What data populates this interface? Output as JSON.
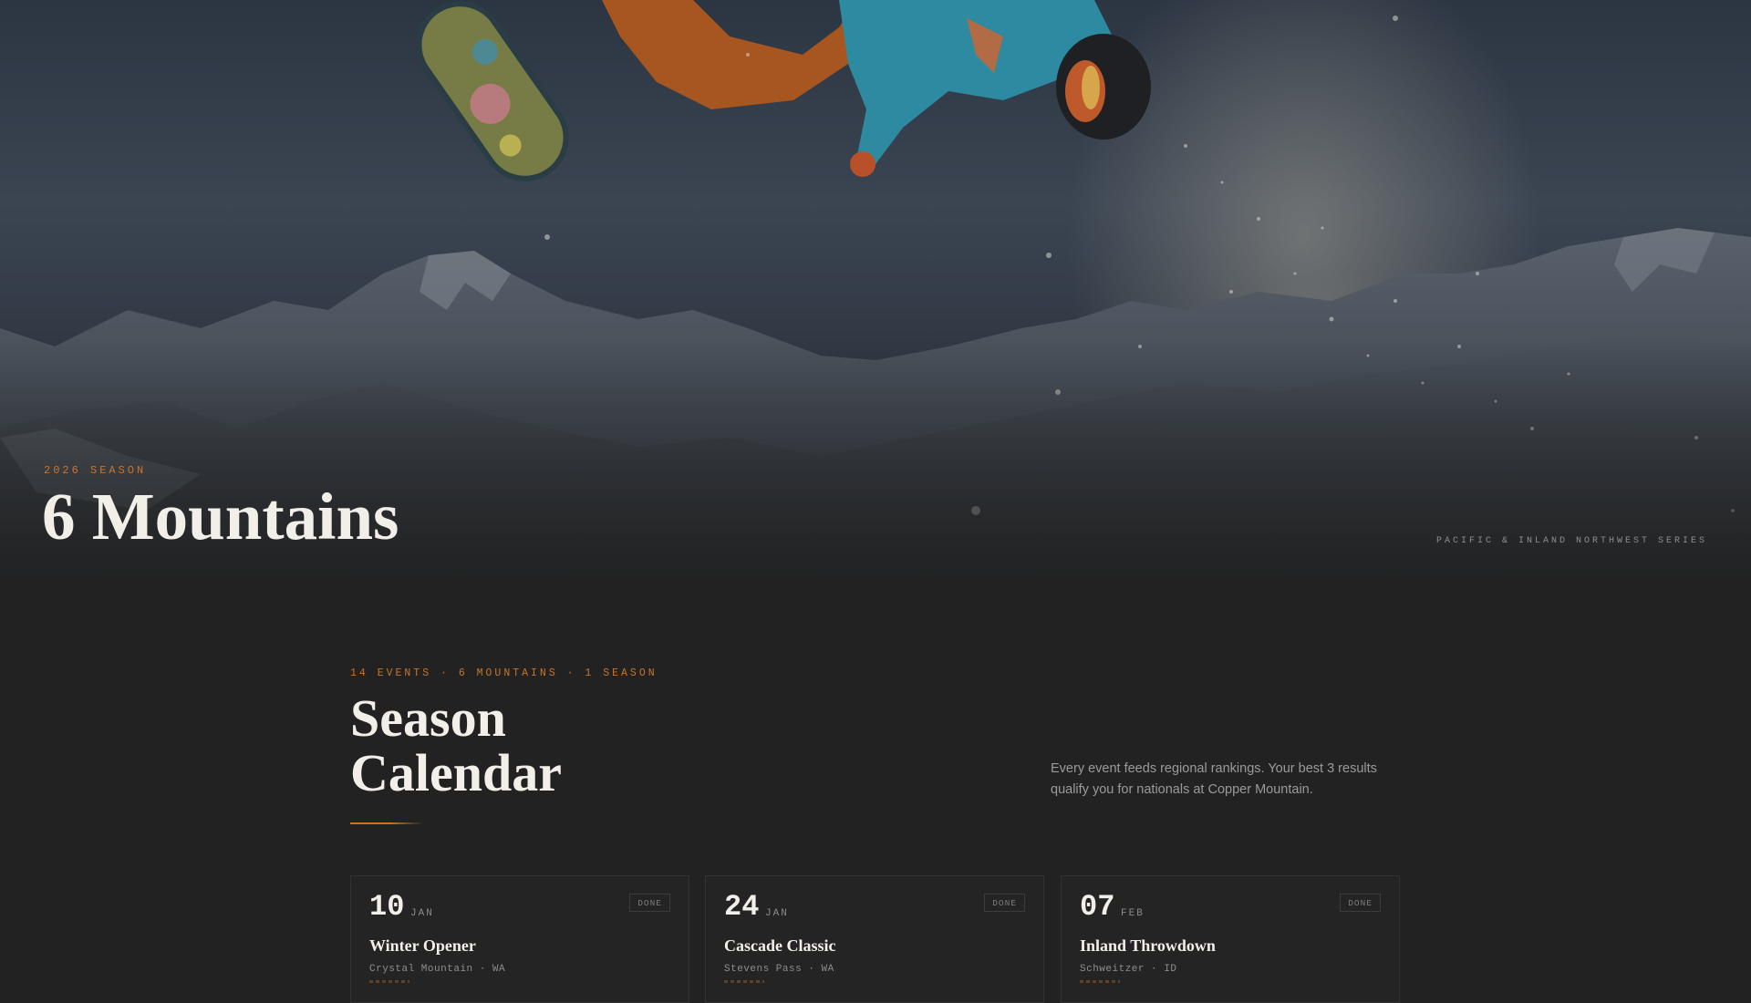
{
  "hero": {
    "eyebrow": "2026 SEASON",
    "title": "6 Mountains",
    "series": "PACIFIC & INLAND NORTHWEST SERIES",
    "background_image": "snowboarder-mountains-photo"
  },
  "calendar": {
    "eyebrow": "14 EVENTS · 6 MOUNTAINS · 1 SEASON",
    "title": "Season Calendar",
    "description": "Every event feeds regional rankings. Your best 3 results qualify you for nationals at Copper Mountain.",
    "events": [
      {
        "day": "10",
        "month": "JAN",
        "status": "DONE",
        "name": "Winter Opener",
        "location": "Crystal Mountain · WA"
      },
      {
        "day": "24",
        "month": "JAN",
        "status": "DONE",
        "name": "Cascade Classic",
        "location": "Stevens Pass · WA"
      },
      {
        "day": "07",
        "month": "FEB",
        "status": "DONE",
        "name": "Inland Throwdown",
        "location": "Schweitzer · ID"
      }
    ]
  },
  "colors": {
    "accent": "#c9742c",
    "background": "#222222",
    "heading": "#f2efe9",
    "muted_text": "#9a9a9a"
  }
}
